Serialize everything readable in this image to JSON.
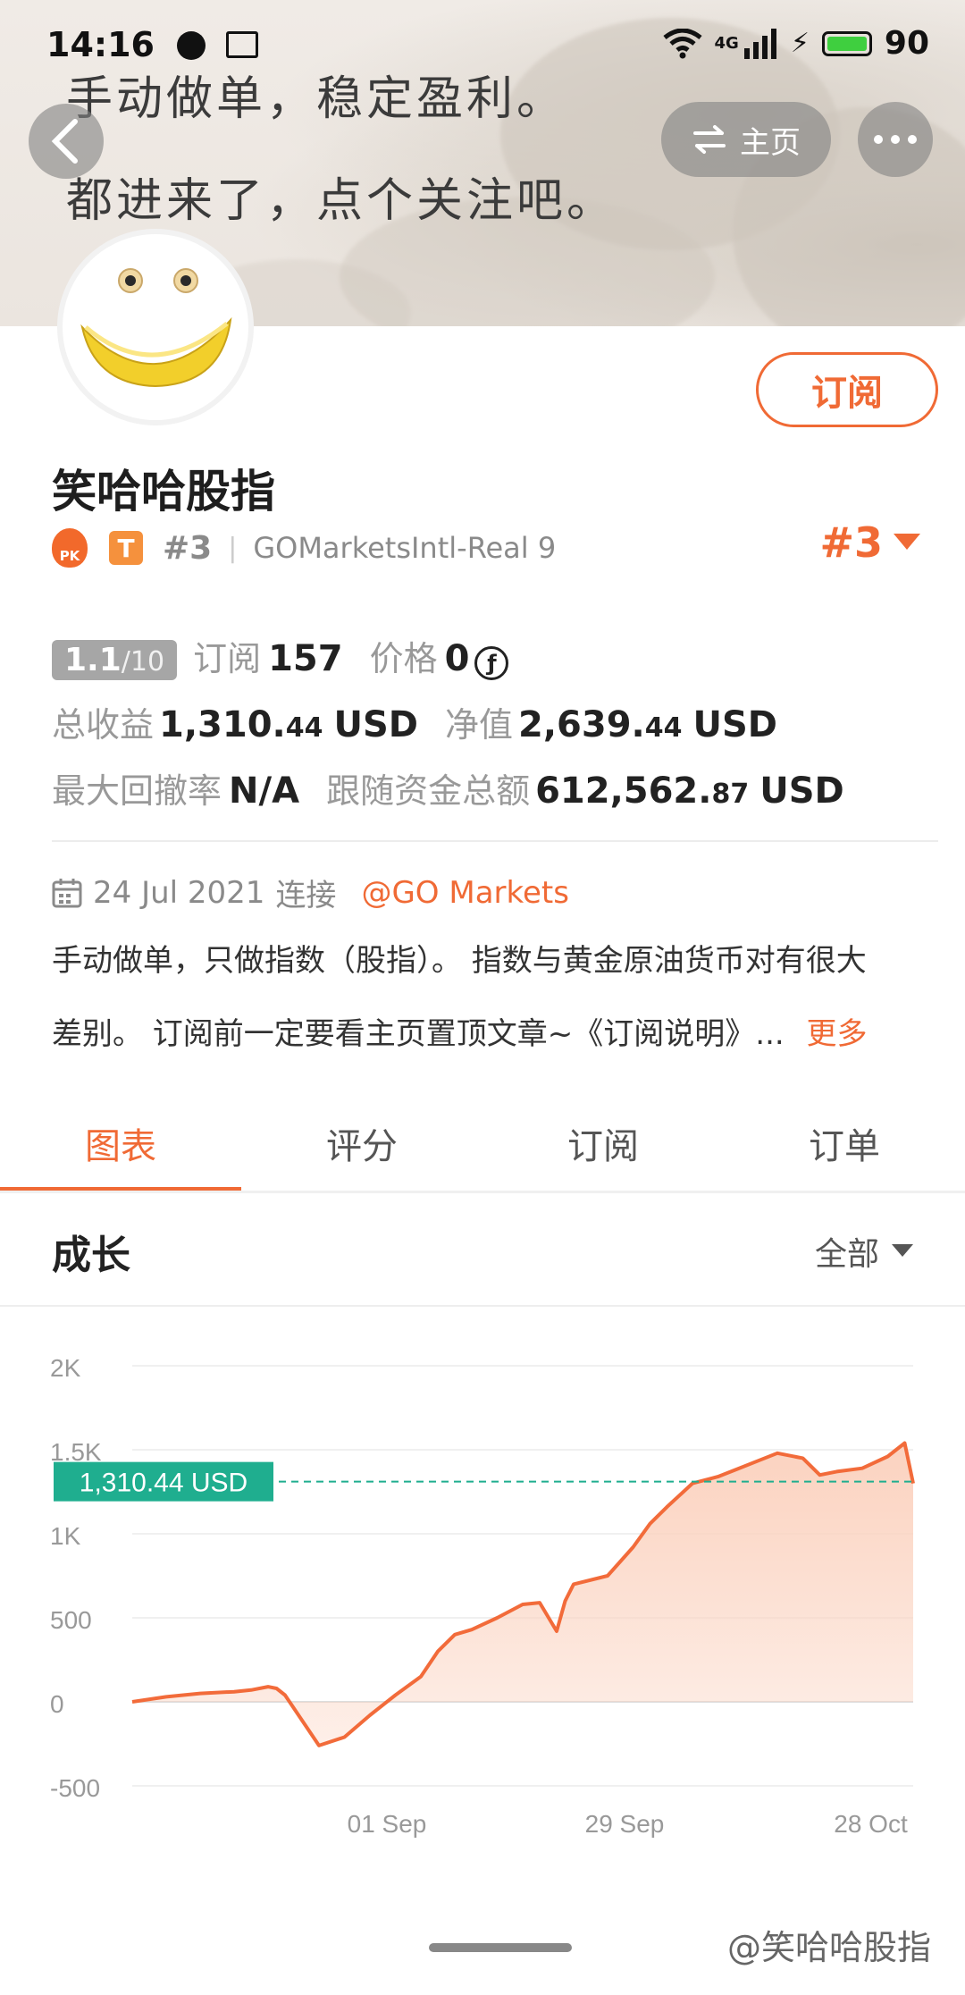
{
  "status_bar": {
    "time": "14:16",
    "network": "4G",
    "battery": "90"
  },
  "banner": {
    "line1": "手动做单，稳定盈利。",
    "line2": "都进来了，点个关注吧。"
  },
  "nav": {
    "home_label": "主页"
  },
  "profile": {
    "subscribe_label": "订阅",
    "name": "笑哈哈股指",
    "pk_badge": "PK",
    "t_badge": "T",
    "rank_small": "#3",
    "broker": "GOMarketsIntl-Real 9",
    "rank_big": "#3"
  },
  "stats": {
    "score_main": "1.1",
    "score_total": "/10",
    "subscribe_label": "订阅",
    "subscribe_count": "157",
    "price_label": "价格",
    "price_value": "0",
    "total_profit_label": "总收益",
    "total_profit_int": "1,310.",
    "total_profit_dec": "44",
    "total_profit_unit": "USD",
    "net_value_label": "净值",
    "net_value_int": "2,639.",
    "net_value_dec": "44",
    "net_value_unit": "USD",
    "drawdown_label": "最大回撤率",
    "drawdown_value": "N/A",
    "follow_funds_label": "跟随资金总额",
    "follow_funds_int": "612,562.",
    "follow_funds_dec": "87",
    "follow_funds_unit": "USD"
  },
  "info": {
    "date": "24 Jul 2021",
    "connect_label": "连接",
    "broker_link": "@GO Markets",
    "desc_line1": "手动做单，只做指数（股指）。 指数与黄金原油货币对有很大",
    "desc_line2": "差别。 订阅前一定要看主页置顶文章~《订阅说明》...",
    "more_label": "更多"
  },
  "tabs": [
    {
      "label": "图表",
      "active": true
    },
    {
      "label": "评分",
      "active": false
    },
    {
      "label": "订阅",
      "active": false
    },
    {
      "label": "订单",
      "active": false
    }
  ],
  "section": {
    "title": "成长",
    "filter_label": "全部"
  },
  "colors": {
    "accent": "#f06a35",
    "reference_label": "#1fae8f",
    "line": "#f26b3a",
    "fill": "#fbd2bf"
  },
  "chart_data": {
    "type": "area",
    "y_ticks": [
      "2K",
      "1.5K",
      "1K",
      "500",
      "0",
      "-500"
    ],
    "y_tick_values": [
      2000,
      1500,
      1000,
      500,
      0,
      -500
    ],
    "x_ticks": [
      "01 Sep",
      "29 Sep",
      "28 Oct"
    ],
    "x_tick_values": [
      "2021-09-01",
      "2021-09-29",
      "2021-10-28"
    ],
    "ylim": [
      -500,
      2000
    ],
    "xlim": [
      "2021-08-02",
      "2021-11-02"
    ],
    "reference_value": 1310.44,
    "reference_label": "1,310.44 USD",
    "x": [
      "2021-08-02",
      "2021-08-06",
      "2021-08-10",
      "2021-08-14",
      "2021-08-16",
      "2021-08-18",
      "2021-08-19",
      "2021-08-20",
      "2021-08-24",
      "2021-08-27",
      "2021-08-30",
      "2021-09-02",
      "2021-09-05",
      "2021-09-07",
      "2021-09-09",
      "2021-09-11",
      "2021-09-14",
      "2021-09-17",
      "2021-09-19",
      "2021-09-21",
      "2021-09-22",
      "2021-09-23",
      "2021-09-27",
      "2021-09-30",
      "2021-10-02",
      "2021-10-04",
      "2021-10-07",
      "2021-10-10",
      "2021-10-12",
      "2021-10-15",
      "2021-10-17",
      "2021-10-20",
      "2021-10-22",
      "2021-10-24",
      "2021-10-27",
      "2021-10-30",
      "2021-11-01",
      "2021-11-02"
    ],
    "y": [
      0,
      30,
      50,
      60,
      70,
      90,
      80,
      40,
      -260,
      -210,
      -80,
      40,
      150,
      300,
      400,
      430,
      500,
      580,
      590,
      420,
      600,
      700,
      750,
      920,
      1060,
      1160,
      1300,
      1340,
      1380,
      1440,
      1480,
      1450,
      1350,
      1370,
      1390,
      1460,
      1540,
      1300
    ]
  }
}
